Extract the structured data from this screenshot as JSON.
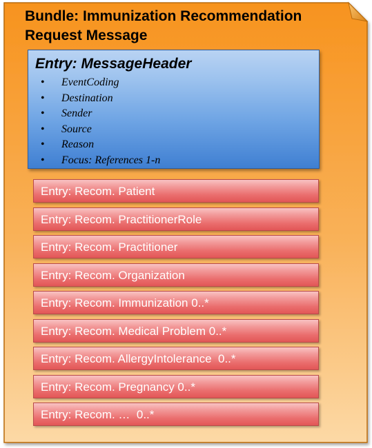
{
  "bundle": {
    "title_line1": "Bundle: Immunization Recommendation",
    "title_line2": "Request Message",
    "colors": {
      "fill_top": "#f7931e",
      "fill_bottom": "#fcd9a6",
      "border": "#b96b0c"
    }
  },
  "message_header": {
    "title": "Entry: MessageHeader",
    "bullet": "•",
    "items": [
      "EventCoding",
      "Destination",
      "Sender",
      "Source",
      "Reason",
      "Focus: References  1-n"
    ],
    "color": "#5a94dc"
  },
  "entries": {
    "color": "#e96666",
    "items": [
      "Entry: Recom. Patient",
      "Entry: Recom. PractitionerRole",
      "Entry: Recom. Practitioner",
      "Entry: Recom. Organization",
      "Entry: Recom. Immunization 0..*",
      "Entry: Recom. Medical Problem 0..*",
      "Entry: Recom. AllergyIntolerance  0..*",
      "Entry: Recom. Pregnancy 0..*",
      "Entry: Recom. …  0..*"
    ]
  }
}
